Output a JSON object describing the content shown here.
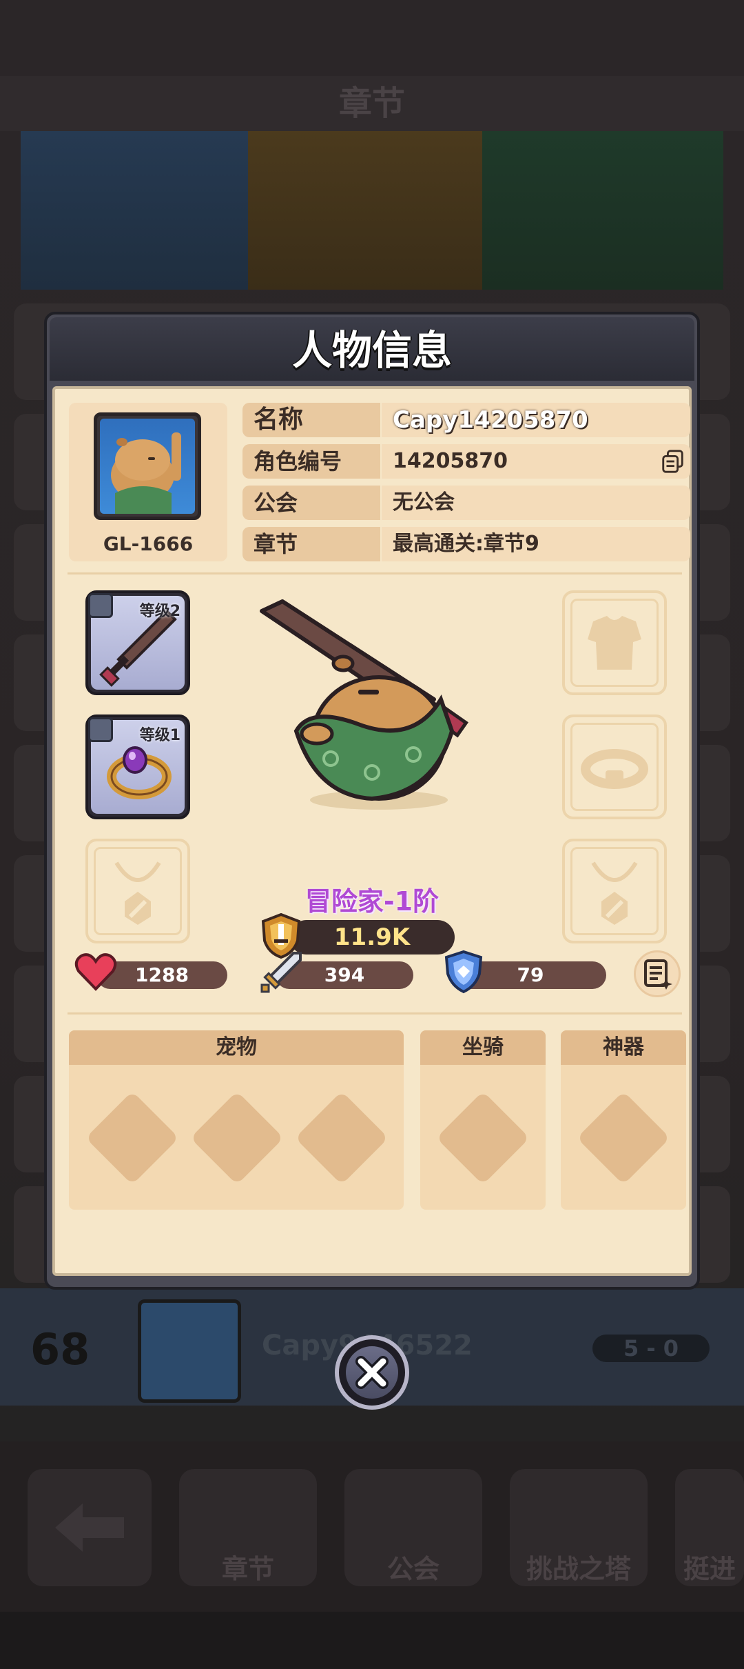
{
  "background": {
    "header_title": "章节",
    "rank": "68",
    "player_name": "Capy9446522",
    "score": "5 - 0",
    "nav": [
      "章节",
      "公会",
      "挑战之塔",
      "挺进"
    ]
  },
  "dialog": {
    "title": "人物信息",
    "avatar_level": "GL-1666",
    "info": [
      {
        "label": "名称",
        "value": "Capy14205870"
      },
      {
        "label": "角色编号",
        "value": "14205870"
      },
      {
        "label": "公会",
        "value": "无公会"
      },
      {
        "label": "章节",
        "value": "最高通关:章节9"
      }
    ],
    "equipment": {
      "weapon_level": "等级2",
      "ring_level": "等级1"
    },
    "class_name": "冒险家-1阶",
    "power": "11.9K",
    "stats": {
      "hp": "1288",
      "attack": "394",
      "defense": "79"
    },
    "panels": {
      "pet": "宠物",
      "mount": "坐骑",
      "artifact": "神器"
    }
  },
  "colors": {
    "parchment": "#f6e7c9",
    "label_tan": "#e9c9a0",
    "class_purple": "#b04ad4",
    "power_gold": "#ffe38a"
  }
}
